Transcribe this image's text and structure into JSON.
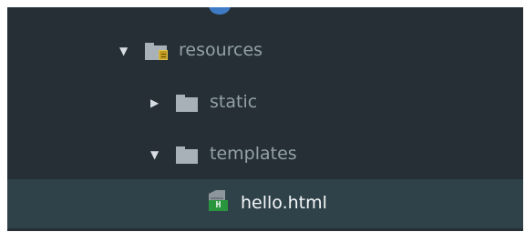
{
  "project_tree": {
    "items": [
      {
        "label": "resources",
        "type": "folder",
        "expanded": true,
        "icon": "resource-folder-icon",
        "arrow": "▼"
      },
      {
        "label": "static",
        "type": "folder",
        "expanded": false,
        "icon": "folder-icon",
        "arrow": "▶"
      },
      {
        "label": "templates",
        "type": "folder",
        "expanded": true,
        "icon": "folder-icon",
        "arrow": "▼"
      },
      {
        "label": "hello.html",
        "type": "file",
        "selected": true,
        "icon": "html-file-icon",
        "icon_text": "H"
      }
    ]
  },
  "colors": {
    "tree_background": "#252f35",
    "selected_row": "#304249",
    "folder_text": "#93a0a9",
    "selected_text": "#f4f8fa",
    "folder_icon": "#a9b1b8",
    "resource_accent": "#c39b21",
    "html_icon": "#29953d"
  }
}
